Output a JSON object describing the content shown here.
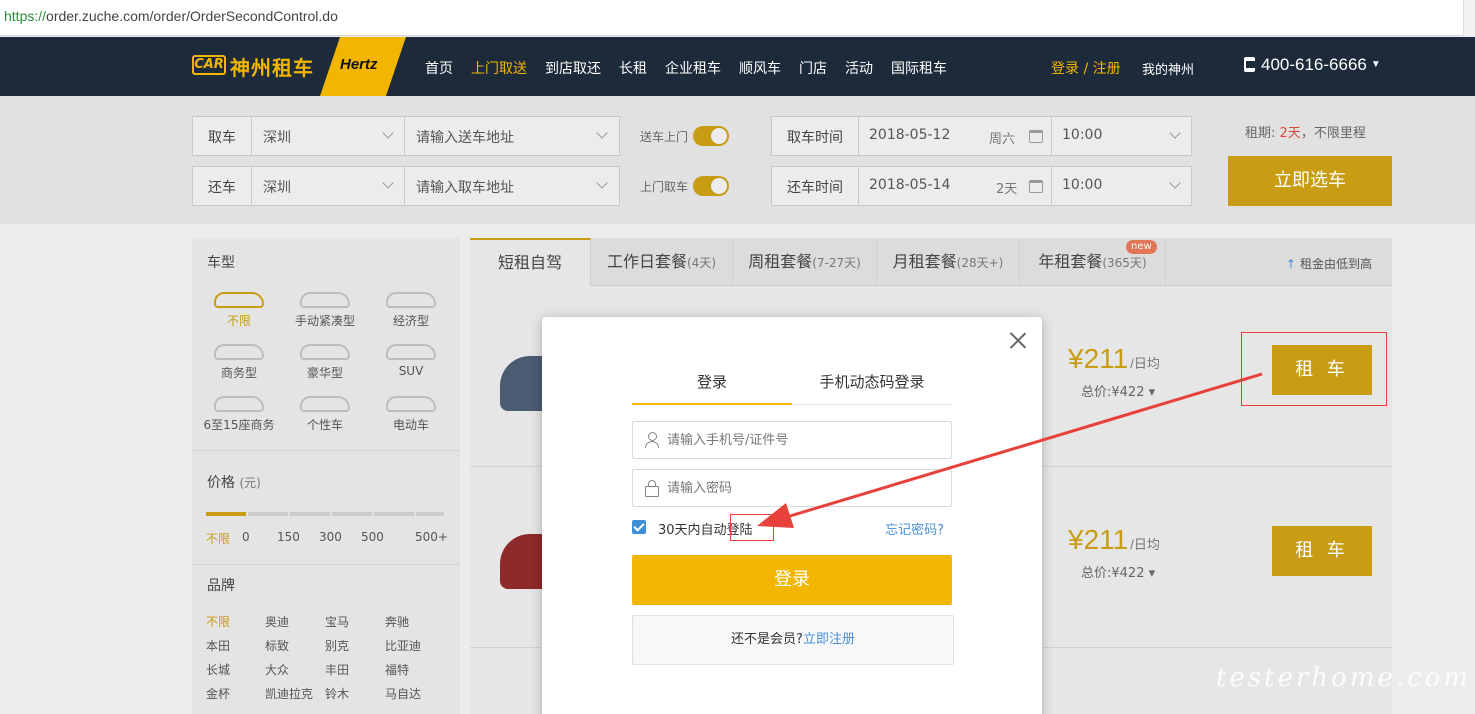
{
  "browser": {
    "url_scheme": "https://",
    "url_rest": "order.zuche.com/order/OrderSecondControl.do"
  },
  "nav": {
    "logo_car": "CAR",
    "logo_text": "神州租车",
    "partner": "Hertz",
    "links": [
      "首页",
      "上门取送",
      "到店取还",
      "长租",
      "企业租车",
      "顺风车",
      "门店",
      "活动",
      "国际租车"
    ],
    "login_register": "登录 / 注册",
    "my": "我的神州",
    "phone": "400-616-6666"
  },
  "search": {
    "pickup_label": "取车",
    "pickup_city": "深圳",
    "pickup_addr_placeholder": "请输入送车地址",
    "return_label": "还车",
    "return_city": "深圳",
    "return_addr_placeholder": "请输入取车地址",
    "deliver_toggle": "送车上门",
    "collect_toggle": "上门取车",
    "pickup_time_label": "取车时间",
    "pickup_date": "2018-05-12",
    "pickup_weekday": "周六",
    "pickup_time": "10:00",
    "return_time_label": "还车时间",
    "return_date": "2018-05-14",
    "return_days": "2天",
    "return_time": "10:00",
    "rent_period_prefix": "租期:",
    "rent_period_days": "2天",
    "rent_period_suffix": "，不限里程",
    "pick_button": "立即选车"
  },
  "filter": {
    "car_type_title": "车型",
    "car_types": [
      "不限",
      "手动紧凑型",
      "经济型",
      "商务型",
      "豪华型",
      "SUV",
      "6至15座商务",
      "个性车",
      "电动车"
    ],
    "price_title": "价格",
    "price_unit": "(元)",
    "price_labels": [
      "不限",
      "0",
      "150",
      "300",
      "500",
      "500+"
    ],
    "brand_title": "品牌",
    "brands": [
      "不限",
      "奥迪",
      "宝马",
      "奔驰",
      "本田",
      "标致",
      "别克",
      "比亚迪",
      "长城",
      "大众",
      "丰田",
      "福特",
      "金杯",
      "凯迪拉克",
      "铃木",
      "马自达"
    ]
  },
  "results": {
    "tabs": [
      {
        "label": "短租自驾",
        "sub": ""
      },
      {
        "label": "工作日套餐",
        "sub": "(4天)"
      },
      {
        "label": "周租套餐",
        "sub": "(7-27天)"
      },
      {
        "label": "月租套餐",
        "sub": "(28天+)"
      },
      {
        "label": "年租套餐",
        "sub": "(365天)"
      }
    ],
    "new_badge": "new",
    "sort_hint": "租金由低到高",
    "rows": [
      {
        "price": "¥211",
        "unit": "/日均",
        "total": "总价:¥422",
        "button": "租 车"
      },
      {
        "price": "¥211",
        "unit": "/日均",
        "total": "总价:¥422",
        "button": "租 车"
      }
    ]
  },
  "modal": {
    "tab_login": "登录",
    "tab_sms": "手机动态码登录",
    "phone_placeholder": "请输入手机号/证件号",
    "password_placeholder": "请输入密码",
    "remember": "30天内自动登陆",
    "forgot": "忘记密码?",
    "login_button": "登录",
    "not_member": "还不是会员?",
    "register_link": "立即注册"
  },
  "watermark": "testerhome.com",
  "colors": {
    "brand_yellow": "#f2b600",
    "nav_bg": "#1c2a3a",
    "link_blue": "#4a8fd4",
    "annotation_red": "#e8413c"
  }
}
